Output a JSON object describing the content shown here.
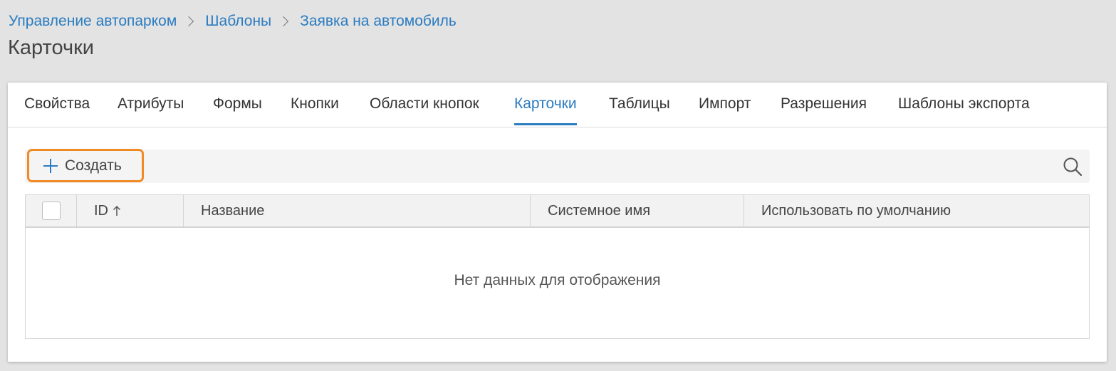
{
  "breadcrumb": {
    "items": [
      "Управление автопарком",
      "Шаблоны",
      "Заявка на автомобиль"
    ]
  },
  "page": {
    "title": "Карточки"
  },
  "tabs": [
    {
      "label": "Свойства",
      "active": false
    },
    {
      "label": "Атрибуты",
      "active": false
    },
    {
      "label": "Формы",
      "active": false
    },
    {
      "label": "Кнопки",
      "active": false
    },
    {
      "label": "Области кнопок",
      "active": false
    },
    {
      "label": "Карточки",
      "active": true
    },
    {
      "label": "Таблицы",
      "active": false
    },
    {
      "label": "Импорт",
      "active": false
    },
    {
      "label": "Разрешения",
      "active": false
    },
    {
      "label": "Шаблоны экспорта",
      "active": false
    }
  ],
  "toolbar": {
    "create_label": "Создать",
    "create_icon": "plus-icon",
    "search_icon": "search-icon"
  },
  "table": {
    "columns": [
      "ID",
      "Название",
      "Системное имя",
      "Использовать по умолчанию"
    ],
    "sort_icon": "arrow-up-icon",
    "empty_text": "Нет данных для отображения"
  },
  "colors": {
    "accent": "#2b7cc0",
    "highlight": "#f08a24",
    "background": "#e3e3e3"
  }
}
